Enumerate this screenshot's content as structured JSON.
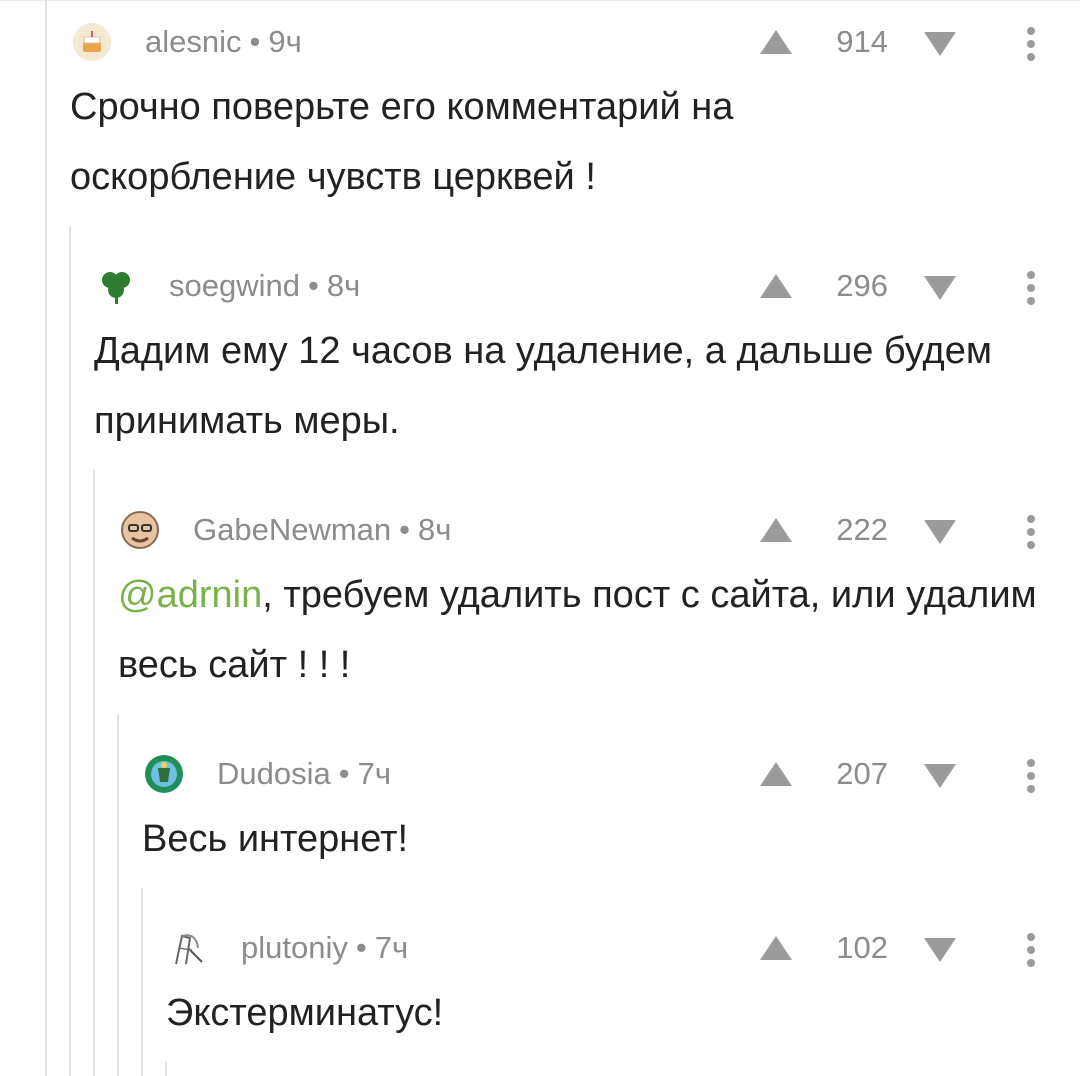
{
  "comments": [
    {
      "user": "alesnic",
      "time": "9ч",
      "votes": "914",
      "text": "Срочно поверьте его комментарий на оскорбление чувств церквей !",
      "avatar": "cake-avatar"
    },
    {
      "user": "soegwind",
      "time": "8ч",
      "votes": "296",
      "text": "Дадим ему 12 часов на удаление, а дальше будем принимать меры.",
      "avatar": "clover-avatar"
    },
    {
      "user": "GabeNewman",
      "time": "8ч",
      "votes": "222",
      "mention": "@adrnin",
      "text": ", требуем удалить пост с сайта, или удалим весь сайт ! ! !",
      "avatar": "face-avatar"
    },
    {
      "user": "Dudosia",
      "time": "7ч",
      "votes": "207",
      "text": "Весь интернет!",
      "avatar": "emblem-avatar"
    },
    {
      "user": "plutoniy",
      "time": "7ч",
      "votes": "102",
      "text": "Экстерминатус!",
      "avatar": "sketch-avatar"
    }
  ],
  "colors": {
    "meta": "#8c8c8c",
    "text": "#222222",
    "mention": "#7ab24a",
    "thread_line": "#e3e3e3",
    "icon": "#9b9b9b"
  }
}
